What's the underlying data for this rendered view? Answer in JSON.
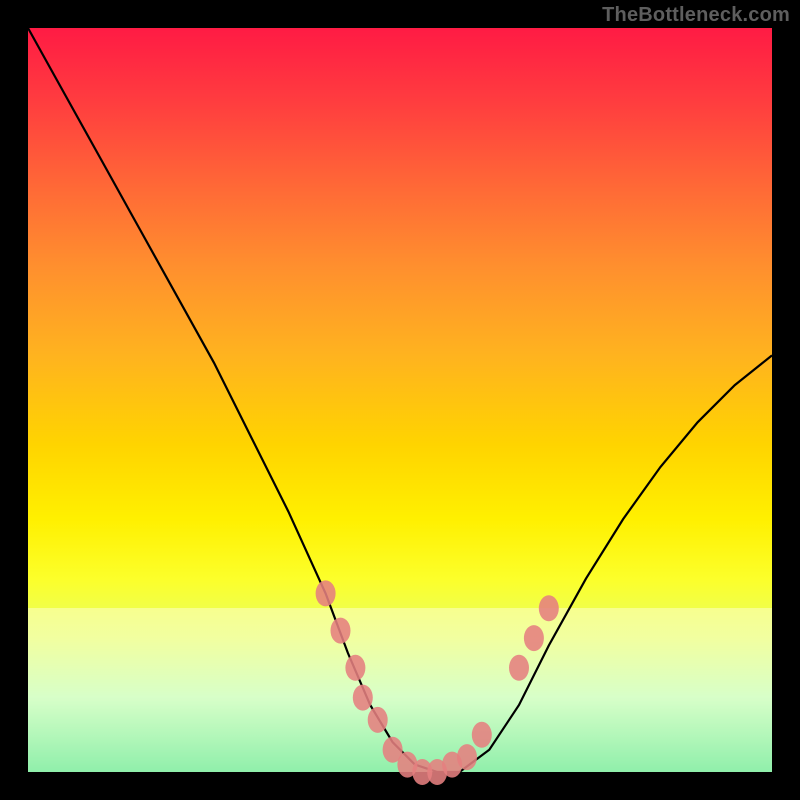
{
  "attribution": "TheBottleneck.com",
  "colors": {
    "dot": "#e58080",
    "curve": "#000000"
  },
  "chart_data": {
    "type": "line",
    "title": "",
    "xlabel": "",
    "ylabel": "",
    "xlim": [
      0,
      100
    ],
    "ylim": [
      0,
      100
    ],
    "grid": false,
    "series": [
      {
        "name": "bottleneck-curve",
        "x": [
          0,
          5,
          10,
          15,
          20,
          25,
          30,
          35,
          40,
          43,
          46,
          49,
          52,
          55,
          58,
          62,
          66,
          70,
          75,
          80,
          85,
          90,
          95,
          100
        ],
        "y": [
          100,
          91,
          82,
          73,
          64,
          55,
          45,
          35,
          24,
          16,
          9,
          4,
          1,
          0,
          0,
          3,
          9,
          17,
          26,
          34,
          41,
          47,
          52,
          56
        ]
      }
    ],
    "highlight_band_y": [
      0,
      22
    ],
    "dots": [
      {
        "x": 40,
        "y": 24
      },
      {
        "x": 42,
        "y": 19
      },
      {
        "x": 44,
        "y": 14
      },
      {
        "x": 45,
        "y": 10
      },
      {
        "x": 47,
        "y": 7
      },
      {
        "x": 49,
        "y": 3
      },
      {
        "x": 51,
        "y": 1
      },
      {
        "x": 53,
        "y": 0
      },
      {
        "x": 55,
        "y": 0
      },
      {
        "x": 57,
        "y": 1
      },
      {
        "x": 59,
        "y": 2
      },
      {
        "x": 61,
        "y": 5
      },
      {
        "x": 66,
        "y": 14
      },
      {
        "x": 68,
        "y": 18
      },
      {
        "x": 70,
        "y": 22
      }
    ]
  }
}
